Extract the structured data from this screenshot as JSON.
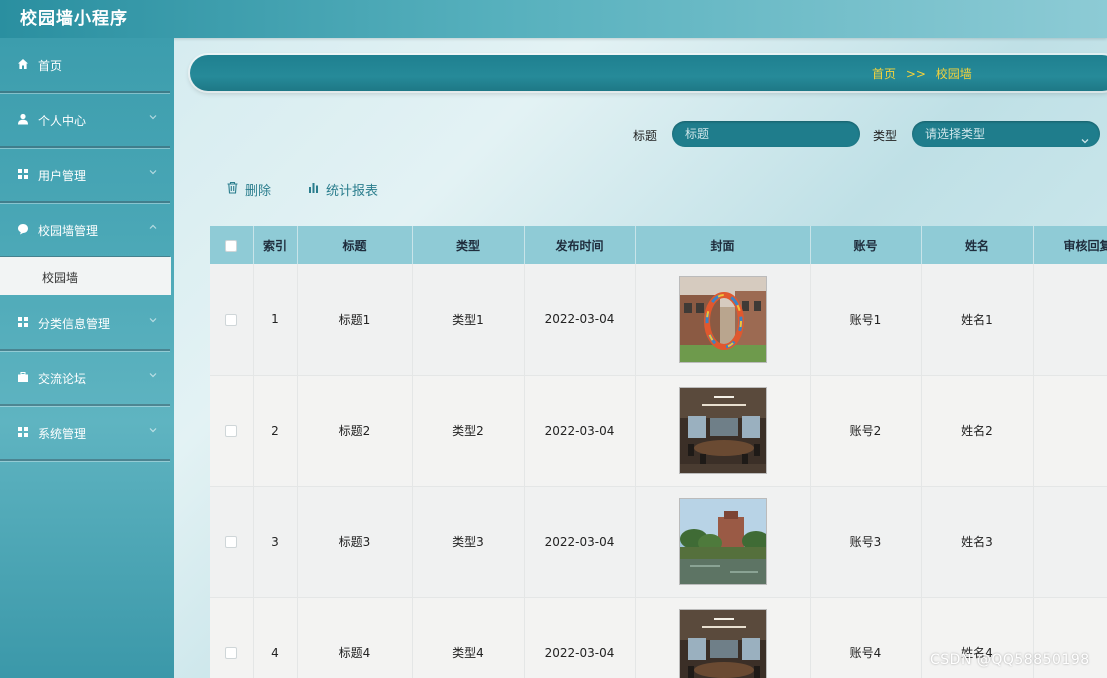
{
  "app": {
    "title": "校园墙小程序"
  },
  "sidebar": {
    "items": [
      {
        "label": "首页",
        "icon": "home-icon"
      },
      {
        "label": "个人中心",
        "icon": "user-icon"
      },
      {
        "label": "用户管理",
        "icon": "grid-icon"
      },
      {
        "label": "校园墙管理",
        "icon": "bubble-icon"
      },
      {
        "label": "分类信息管理",
        "icon": "grid-icon"
      },
      {
        "label": "交流论坛",
        "icon": "briefcase-icon"
      },
      {
        "label": "系统管理",
        "icon": "grid-icon"
      }
    ],
    "submenu": {
      "label": "校园墙"
    }
  },
  "breadcrumb": {
    "home": "首页",
    "separator": ">>",
    "current": "校园墙"
  },
  "search": {
    "title_label": "标题",
    "title_placeholder": "标题",
    "type_label": "类型",
    "type_placeholder": "请选择类型"
  },
  "actions": {
    "delete": "删除",
    "report": "统计报表"
  },
  "table": {
    "columns": [
      "索引",
      "标题",
      "类型",
      "发布时间",
      "封面",
      "账号",
      "姓名",
      "审核回复"
    ],
    "rows": [
      {
        "index": "1",
        "title": "标题1",
        "type": "类型1",
        "time": "2022-03-04",
        "cover": "campus-sculpture",
        "account": "账号1",
        "name": "姓名1"
      },
      {
        "index": "2",
        "title": "标题2",
        "type": "类型2",
        "time": "2022-03-04",
        "cover": "meeting-room",
        "account": "账号2",
        "name": "姓名2"
      },
      {
        "index": "3",
        "title": "标题3",
        "type": "类型3",
        "time": "2022-03-04",
        "cover": "campus-lake",
        "account": "账号3",
        "name": "姓名3"
      },
      {
        "index": "4",
        "title": "标题4",
        "type": "类型4",
        "time": "2022-03-04",
        "cover": "meeting-room",
        "account": "账号4",
        "name": "姓名4"
      }
    ]
  },
  "watermark": "CSDN @QQ58850198",
  "colors": {
    "primary": "#1f7d8c",
    "header": "#8fcbd6",
    "accent": "#f5d33b"
  }
}
